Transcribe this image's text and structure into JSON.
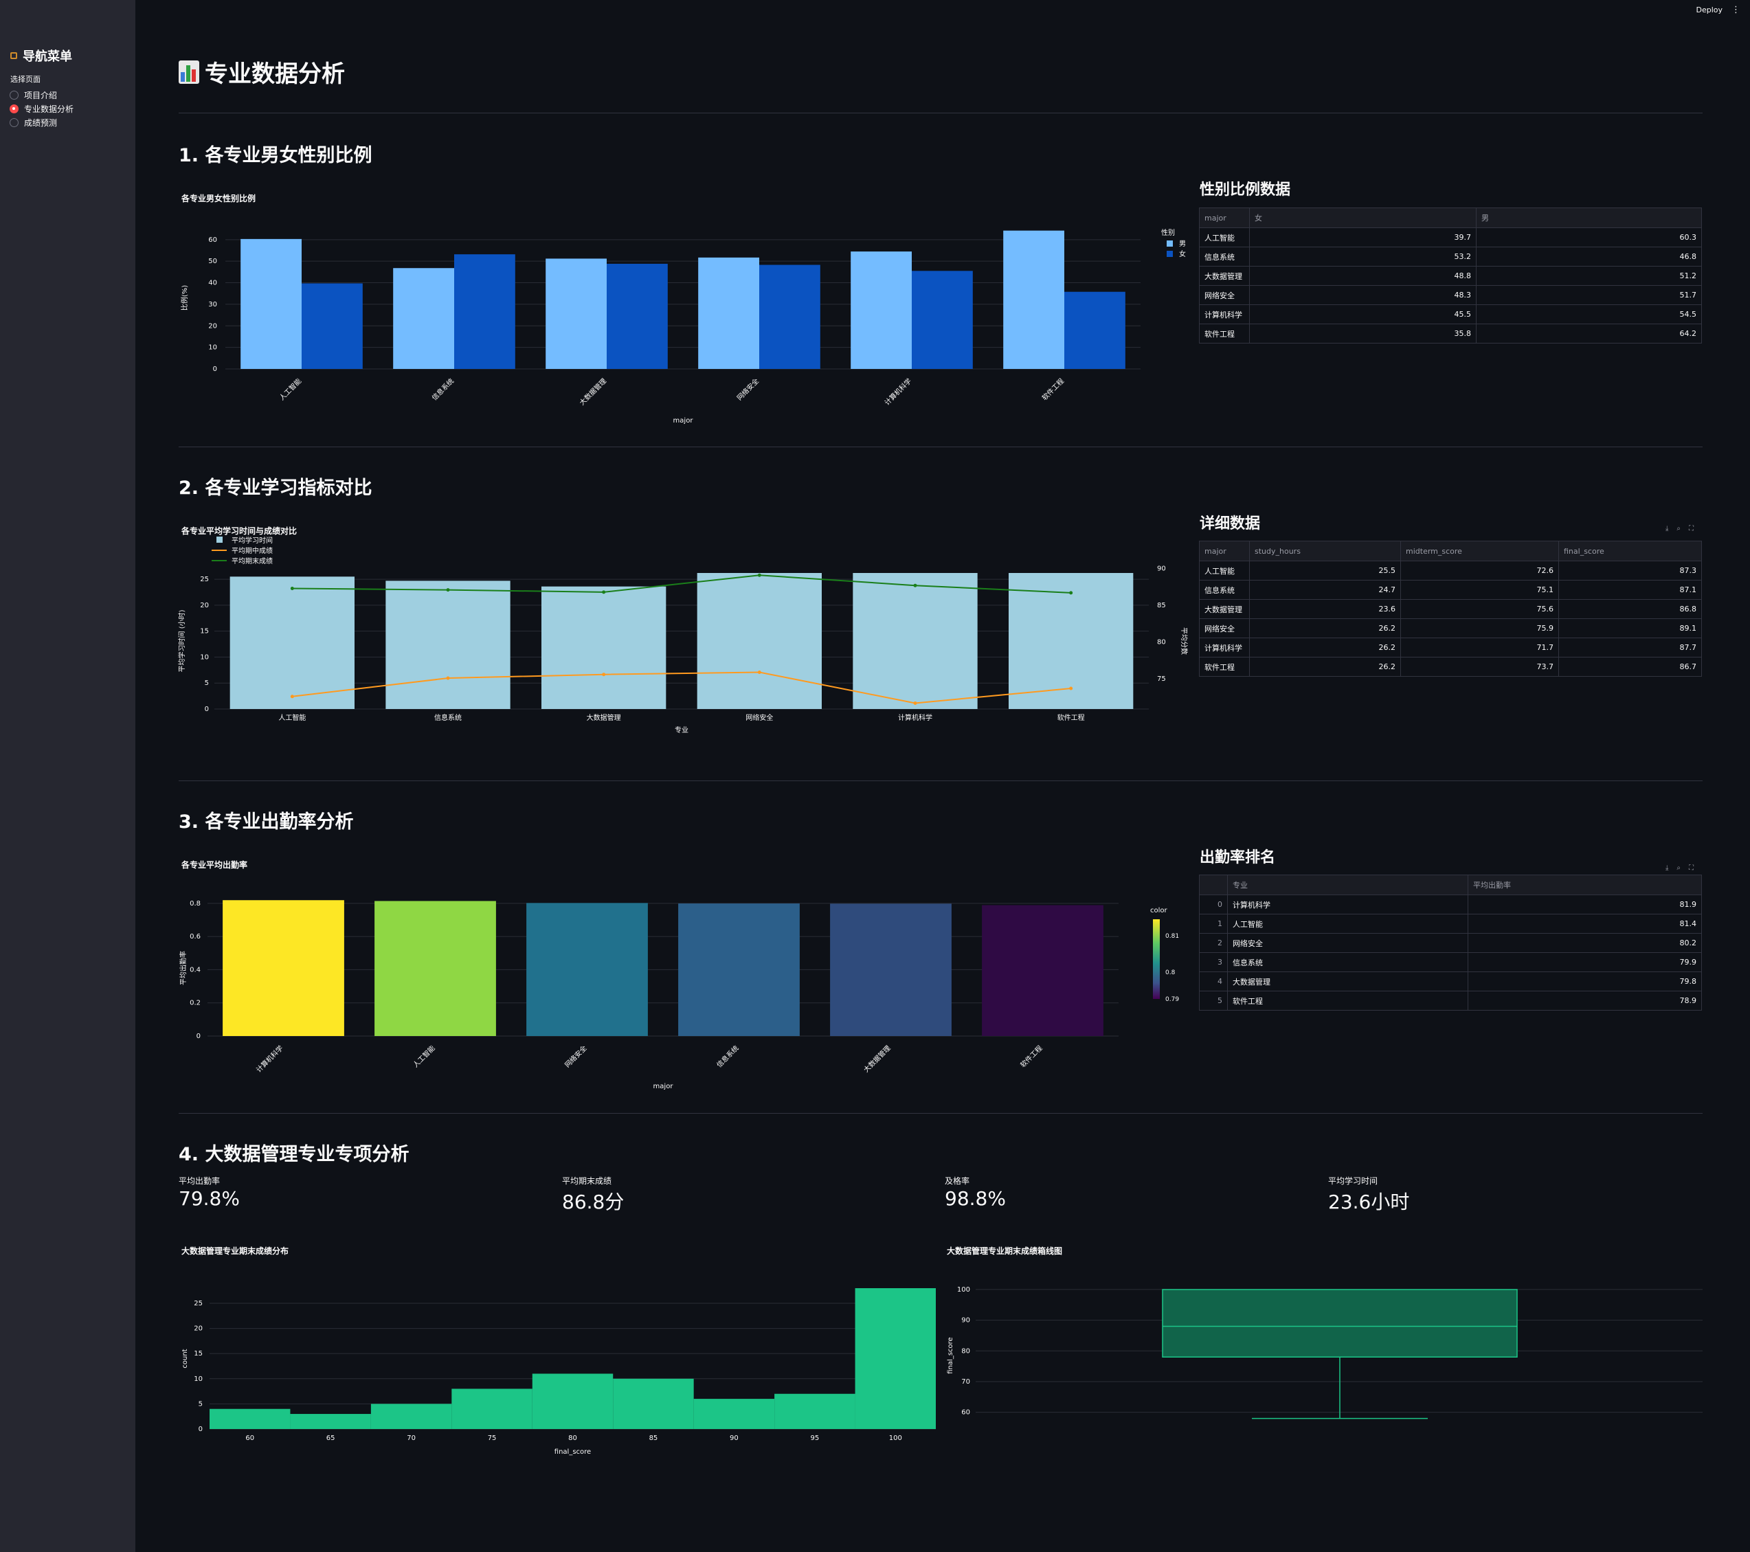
{
  "sidebar": {
    "title": "导航菜单",
    "select_label": "选择页面",
    "options": [
      {
        "label": "项目介绍",
        "selected": false
      },
      {
        "label": "专业数据分析",
        "selected": true
      },
      {
        "label": "成绩预测",
        "selected": false
      }
    ]
  },
  "topbar": {
    "deploy_label": "Deploy",
    "menu_icon": "kebab-menu-icon"
  },
  "page": {
    "title": "专业数据分析",
    "title_icon": "bar-chart-emoji-icon"
  },
  "sections": {
    "s1": {
      "heading": "1. 各专业男女性别比例",
      "table_heading": "性别比例数据"
    },
    "s2": {
      "heading": "2. 各专业学习指标对比",
      "table_heading": "详细数据"
    },
    "s3": {
      "heading": "3. 各专业出勤率分析",
      "table_heading": "出勤率排名"
    },
    "s4": {
      "heading": "4. 大数据管理专业专项分析"
    }
  },
  "gender_table": {
    "columns": [
      "major",
      "女",
      "男"
    ],
    "rows": [
      [
        "人工智能",
        "39.7",
        "60.3"
      ],
      [
        "信息系统",
        "53.2",
        "46.8"
      ],
      [
        "大数据管理",
        "48.8",
        "51.2"
      ],
      [
        "网络安全",
        "48.3",
        "51.7"
      ],
      [
        "计算机科学",
        "45.5",
        "54.5"
      ],
      [
        "软件工程",
        "35.8",
        "64.2"
      ]
    ]
  },
  "detail_table": {
    "columns": [
      "major",
      "study_hours",
      "midterm_score",
      "final_score"
    ],
    "rows": [
      [
        "人工智能",
        "25.5",
        "72.6",
        "87.3"
      ],
      [
        "信息系统",
        "24.7",
        "75.1",
        "87.1"
      ],
      [
        "大数据管理",
        "23.6",
        "75.6",
        "86.8"
      ],
      [
        "网络安全",
        "26.2",
        "75.9",
        "89.1"
      ],
      [
        "计算机科学",
        "26.2",
        "71.7",
        "87.7"
      ],
      [
        "软件工程",
        "26.2",
        "73.7",
        "86.7"
      ]
    ]
  },
  "attendance_table": {
    "columns": [
      "",
      "专业",
      "平均出勤率"
    ],
    "rows": [
      [
        "0",
        "计算机科学",
        "81.9"
      ],
      [
        "1",
        "人工智能",
        "81.4"
      ],
      [
        "2",
        "网络安全",
        "80.2"
      ],
      [
        "3",
        "信息系统",
        "79.9"
      ],
      [
        "4",
        "大数据管理",
        "79.8"
      ],
      [
        "5",
        "软件工程",
        "78.9"
      ]
    ]
  },
  "metrics": [
    {
      "label": "平均出勤率",
      "value": "79.8%"
    },
    {
      "label": "平均期末成绩",
      "value": "86.8分"
    },
    {
      "label": "及格率",
      "value": "98.8%"
    },
    {
      "label": "平均学习时间",
      "value": "23.6小时"
    }
  ],
  "chart_data": [
    {
      "id": "gender",
      "type": "bar",
      "title": "各专业男女性别比例",
      "xlabel": "major",
      "ylabel": "比例(%)",
      "categories": [
        "人工智能",
        "信息系统",
        "大数据管理",
        "网络安全",
        "计算机科学",
        "软件工程"
      ],
      "series": [
        {
          "name": "男",
          "values": [
            60.3,
            46.8,
            51.2,
            51.7,
            54.5,
            64.2
          ],
          "color": "#74bcff"
        },
        {
          "name": "女",
          "values": [
            39.7,
            53.2,
            48.8,
            48.3,
            45.5,
            35.8
          ],
          "color": "#0b53c1"
        }
      ],
      "legend_title": "性别",
      "ylim": [
        0,
        66
      ],
      "yticks": [
        0,
        10,
        20,
        30,
        40,
        50,
        60
      ]
    },
    {
      "id": "study",
      "type": "bar",
      "title": "各专业平均学习时间与成绩对比",
      "xlabel": "专业",
      "ylabel": "平均学习时间 (小时)",
      "y2label": "平均分数",
      "categories": [
        "人工智能",
        "信息系统",
        "大数据管理",
        "网络安全",
        "计算机科学",
        "软件工程"
      ],
      "series": [
        {
          "name": "平均学习时间",
          "type": "bar",
          "axis": "y",
          "values": [
            25.5,
            24.7,
            23.6,
            26.2,
            26.2,
            26.2
          ],
          "color": "#9fcfe0"
        },
        {
          "name": "平均期中成绩",
          "type": "line",
          "axis": "y2",
          "values": [
            72.6,
            75.1,
            75.6,
            75.9,
            71.7,
            73.7
          ],
          "color": "#ff9a1f"
        },
        {
          "name": "平均期末成绩",
          "type": "line",
          "axis": "y2",
          "values": [
            87.3,
            87.1,
            86.8,
            89.1,
            87.7,
            86.7
          ],
          "color": "#1a7f1a"
        }
      ],
      "ylim": [
        0,
        26.2
      ],
      "yticks": [
        0,
        5,
        10,
        15,
        20,
        25
      ],
      "y2lim": [
        70.9,
        89.4
      ],
      "y2ticks": [
        75,
        80,
        85,
        90
      ]
    },
    {
      "id": "attendance",
      "type": "bar",
      "title": "各专业平均出勤率",
      "xlabel": "major",
      "ylabel": "平均出勤率",
      "categories": [
        "计算机科学",
        "人工智能",
        "网络安全",
        "信息系统",
        "大数据管理",
        "软件工程"
      ],
      "values": [
        0.819,
        0.814,
        0.802,
        0.799,
        0.798,
        0.789
      ],
      "colors": [
        "#fde725",
        "#8fd744",
        "#21718d",
        "#2c5f8a",
        "#2f4b7c",
        "#2f0a44"
      ],
      "colorbar": {
        "title": "color",
        "ticks": [
          "0.81",
          "0.8",
          "0.79"
        ]
      },
      "ylim": [
        0,
        0.82
      ],
      "yticks": [
        0,
        0.2,
        0.4,
        0.6,
        0.8
      ]
    },
    {
      "id": "hist",
      "type": "bar",
      "title": "大数据管理专业期末成绩分布",
      "xlabel": "final_score",
      "ylabel": "count",
      "bins_start": 57.5,
      "bin_width": 5,
      "values": [
        4,
        3,
        5,
        8,
        11,
        10,
        6,
        7,
        28
      ],
      "color": "#1cc587",
      "xlim": [
        57.5,
        102.5
      ],
      "xticks": [
        60,
        65,
        70,
        75,
        80,
        85,
        90,
        95,
        100
      ],
      "ylim": [
        0,
        28
      ],
      "yticks": [
        0,
        5,
        10,
        15,
        20,
        25
      ]
    },
    {
      "id": "box",
      "type": "box",
      "title": "大数据管理专业期末成绩箱线图",
      "ylabel": "final_score",
      "min": 58,
      "q1": 78,
      "median": 88,
      "q3": 100,
      "max": 100,
      "color": "#1cc587",
      "ylim": [
        55,
        102
      ],
      "yticks": [
        60,
        70,
        80,
        90,
        100
      ]
    }
  ]
}
